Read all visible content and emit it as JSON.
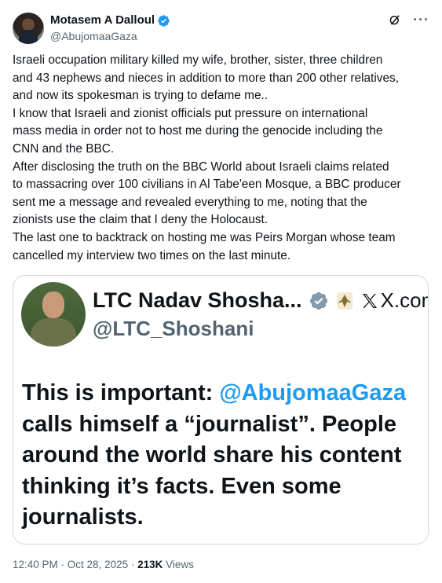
{
  "author": {
    "display_name": "Motasem A Dalloul",
    "handle": "@AbujomaaGaza",
    "verified": true
  },
  "header_icons": [
    "grok-icon",
    "more-icon"
  ],
  "more_label": "···",
  "tweet_text_lines": [
    "Israeli occupation military killed my wife, brother, sister, three children",
    "and 43 nephews and nieces in addition to more than 200 other relatives,",
    "and now its spokesman is trying to defame me..",
    "I know that Israeli and zionist officials put pressure on international",
    "mass media in order not to host me during the genocide including the",
    "CNN and the BBC.",
    "After disclosing the truth on the BBC World about Israeli claims related",
    "to massacring over 100 civilians in Al Tabe'een Mosque, a BBC producer",
    "sent me a message and revealed everything to me, noting that the",
    "zionists use the claim that I deny the Holocaust.",
    "The last one to backtrack on hosting me was Peirs Morgan whose team",
    "cancelled my interview two times on the last minute."
  ],
  "quoted": {
    "display_name": "LTC Nadav Shosha...",
    "handle": "@LTC_Shoshani",
    "x_label": "X.com",
    "line1_prefix": "This is important: ",
    "line1_mention": "@AbujomaaGaza",
    "lines": [
      "calls himself a “journalist”. People",
      "around the world share his content",
      "thinking it’s facts. Even some",
      "journalists."
    ]
  },
  "meta": {
    "time": "12:40 PM",
    "separator": " · ",
    "date": "Oct 28, 2025",
    "views_count": "213K",
    "views_label": " Views"
  },
  "colors": {
    "verified_blue": "#1d9bf0",
    "mention_blue": "#1d9bf0",
    "secondary_text": "#536471",
    "border": "#cfd9de"
  }
}
